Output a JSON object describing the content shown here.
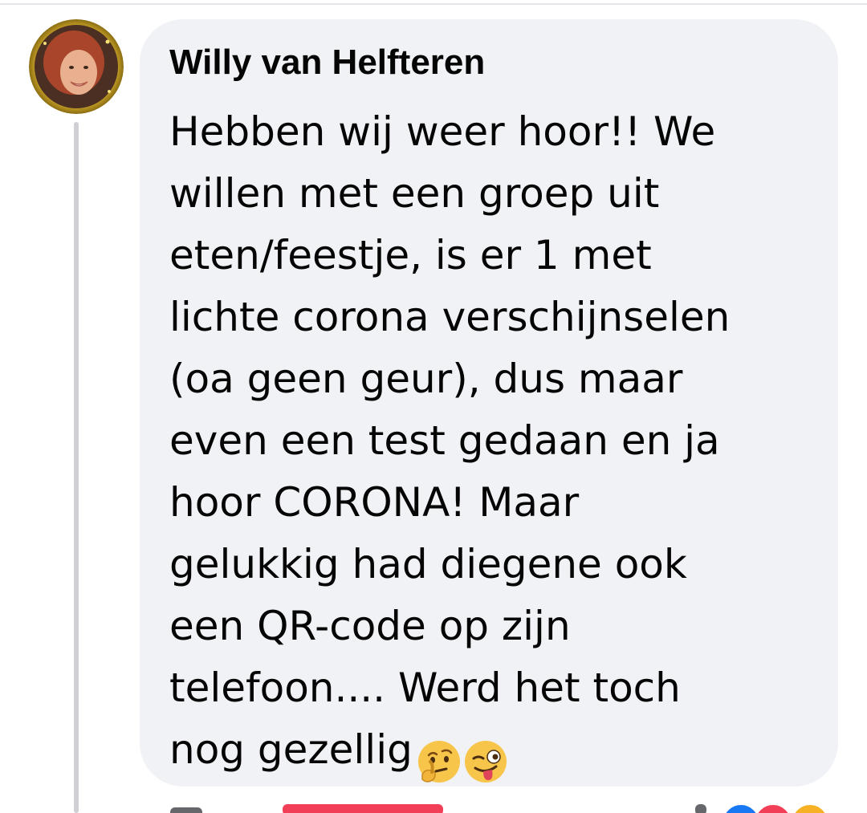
{
  "comment": {
    "author": "Willy van Helfteren",
    "lines": [
      "Hebben wij weer hoor!! We",
      "willen met een groep uit",
      "eten/feestje, is er 1 met",
      "lichte corona verschijnselen",
      "(oa geen geur), dus maar",
      "even een test gedaan en ja",
      "hoor CORONA! Maar",
      "gelukkig had diegene ook",
      "een QR-code op zijn",
      "telefoon.... Werd het toch",
      "nog gezellig"
    ],
    "emojis": [
      "thinking-face-emoji",
      "winking-face-with-tongue-emoji"
    ]
  },
  "reactions": {
    "icons": [
      "like-reaction-icon",
      "love-reaction-icon",
      "haha-reaction-icon"
    ]
  },
  "colors": {
    "bubble": "#f0f2f5",
    "text": "#050505",
    "thread_line": "#ced0d4",
    "like": "#1877f2",
    "love": "#f33e58",
    "haha": "#f7b125"
  }
}
